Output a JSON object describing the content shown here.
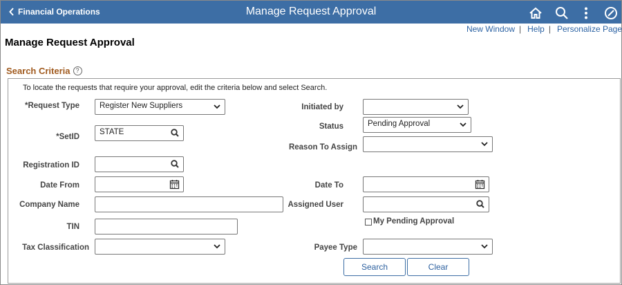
{
  "header": {
    "back_label": "Financial Operations",
    "title": "Manage Request Approval",
    "icons": [
      "home-icon",
      "search-icon",
      "actions-menu-icon",
      "navbar-icon"
    ],
    "bg_color": "#3d6ea5"
  },
  "links": {
    "new_window": "New Window",
    "help": "Help",
    "personalize": "Personalize Page"
  },
  "page_title": "Manage Request Approval",
  "search_criteria": {
    "title": "Search Criteria",
    "help_glyph": "?",
    "instructions": "To locate the requests that require your approval, edit the criteria below and select Search."
  },
  "form": {
    "request_type": {
      "label": "*Request Type",
      "value": "Register New Suppliers"
    },
    "setid": {
      "label": "*SetID",
      "value": "STATE"
    },
    "registration_id": {
      "label": "Registration ID",
      "value": ""
    },
    "date_from": {
      "label": "Date From",
      "value": ""
    },
    "company_name": {
      "label": "Company Name",
      "value": ""
    },
    "tin": {
      "label": "TIN",
      "value": ""
    },
    "tax_classification": {
      "label": "Tax Classification",
      "value": ""
    },
    "initiated_by": {
      "label": "Initiated by",
      "value": ""
    },
    "status": {
      "label": "Status",
      "value": "Pending Approval"
    },
    "reason_to_assign": {
      "label": "Reason To Assign",
      "value": ""
    },
    "date_to": {
      "label": "Date To",
      "value": ""
    },
    "assigned_user": {
      "label": "Assigned User",
      "value": ""
    },
    "my_pending_approval": {
      "label": "My Pending Approval",
      "checked": false
    },
    "payee_type": {
      "label": "Payee Type",
      "value": ""
    }
  },
  "buttons": {
    "search": "Search",
    "clear": "Clear"
  },
  "colors": {
    "section_title": "#a05a1e",
    "link": "#2b62a3"
  }
}
